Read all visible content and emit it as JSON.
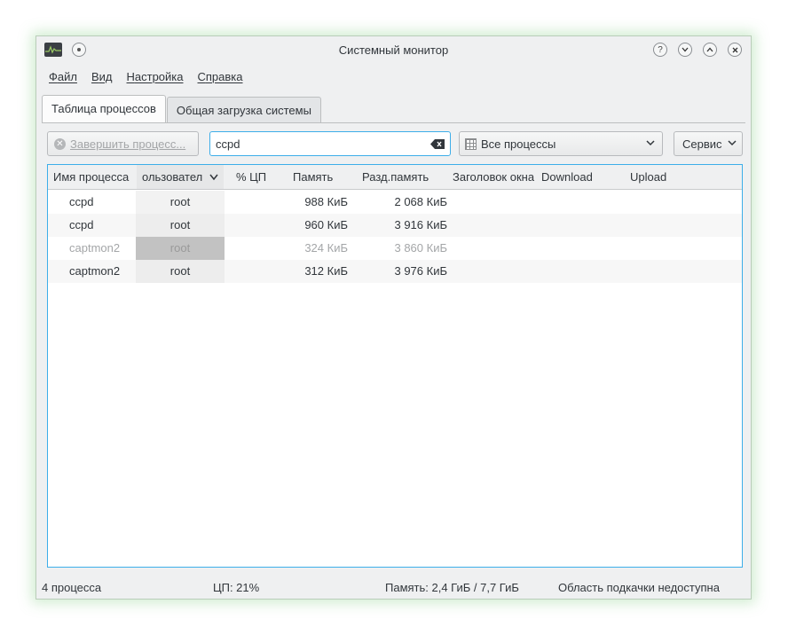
{
  "window": {
    "title": "Системный монитор",
    "help_glyph": "?",
    "minimize_glyph": "⌄",
    "maximize_glyph": "⌃",
    "close_glyph": "✕"
  },
  "menu": [
    {
      "label_accel": "Ф",
      "label_rest": "айл"
    },
    {
      "label_accel": "В",
      "label_rest": "ид"
    },
    {
      "label_accel": "Н",
      "label_rest": "астройка"
    },
    {
      "label_accel": "С",
      "label_rest": "правка"
    }
  ],
  "tabs": {
    "processes": "Таблица процессов",
    "system_load": "Общая загрузка системы"
  },
  "toolbar": {
    "end_process_label": "Завершить процесс...",
    "search_value": "ccpd",
    "process_filter": "Все процессы",
    "service_label": "Сервис"
  },
  "columns": {
    "name": "Имя процесса",
    "user": "ользовател",
    "cpu": "% ЦП",
    "memory": "Память",
    "shared": "Разд.память",
    "window_title": "Заголовок окна",
    "download": "Download",
    "upload": "Upload"
  },
  "rows": [
    {
      "name": "ccpd",
      "user": "root",
      "memory": "988 КиБ",
      "shared": "2 068 КиБ"
    },
    {
      "name": "ccpd",
      "user": "root",
      "memory": "960 КиБ",
      "shared": "3 916 КиБ"
    },
    {
      "name": "captmon2",
      "user": "root",
      "memory": "324 КиБ",
      "shared": "3 860 КиБ"
    },
    {
      "name": "captmon2",
      "user": "root",
      "memory": "312 КиБ",
      "shared": "3 976 КиБ"
    }
  ],
  "status": {
    "process_count": "4 процесса",
    "cpu": "ЦП: 21%",
    "memory": "Память: 2,4 ГиБ / 7,7 ГиБ",
    "swap": "Область подкачки недоступна"
  },
  "colors": {
    "accent": "#3daee9",
    "window_bg": "#eff0f1",
    "text": "#31363b",
    "disabled_text": "#a4a6a8"
  },
  "icons": {
    "app": "system-monitor-icon",
    "clear": "clear-text-icon",
    "list": "list-view-icon"
  }
}
